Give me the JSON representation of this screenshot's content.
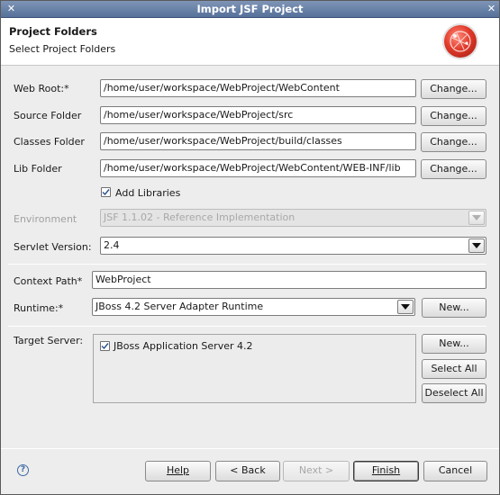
{
  "window": {
    "title": "Import JSF Project"
  },
  "header": {
    "title": "Project Folders",
    "subtitle": "Select Project Folders"
  },
  "folders": {
    "web_root": {
      "label": "Web Root:*",
      "value": "/home/user/workspace/WebProject/WebContent",
      "button": "Change..."
    },
    "source": {
      "label": "Source Folder",
      "value": "/home/user/workspace/WebProject/src",
      "button": "Change..."
    },
    "classes": {
      "label": "Classes Folder",
      "value": "/home/user/workspace/WebProject/build/classes",
      "button": "Change..."
    },
    "lib": {
      "label": "Lib Folder",
      "value": "/home/user/workspace/WebProject/WebContent/WEB-INF/lib",
      "button": "Change..."
    },
    "add_libraries": {
      "label": "Add Libraries",
      "checked": true
    }
  },
  "environment": {
    "label": "Environment",
    "value": "JSF 1.1.02 - Reference Implementation"
  },
  "servlet": {
    "label": "Servlet Version:",
    "value": "2.4"
  },
  "context": {
    "label": "Context Path*",
    "value": "WebProject"
  },
  "runtime": {
    "label": "Runtime:*",
    "value": "JBoss 4.2 Server Adapter Runtime",
    "button": "New..."
  },
  "target": {
    "label": "Target Server:",
    "servers": [
      {
        "name": "JBoss Application Server 4.2",
        "checked": true
      }
    ],
    "new_button": "New...",
    "select_all_button": "Select All",
    "deselect_all_button": "Deselect All"
  },
  "footer": {
    "help_button": "Help",
    "back_button": "< Back",
    "next_button": "Next >",
    "finish_button": "Finish",
    "cancel_button": "Cancel"
  },
  "icons": {
    "logo": "jboss-tools-logo-icon",
    "help": "help-icon",
    "checkbox": "checkmark-icon",
    "combo": "chevron-down-icon"
  }
}
